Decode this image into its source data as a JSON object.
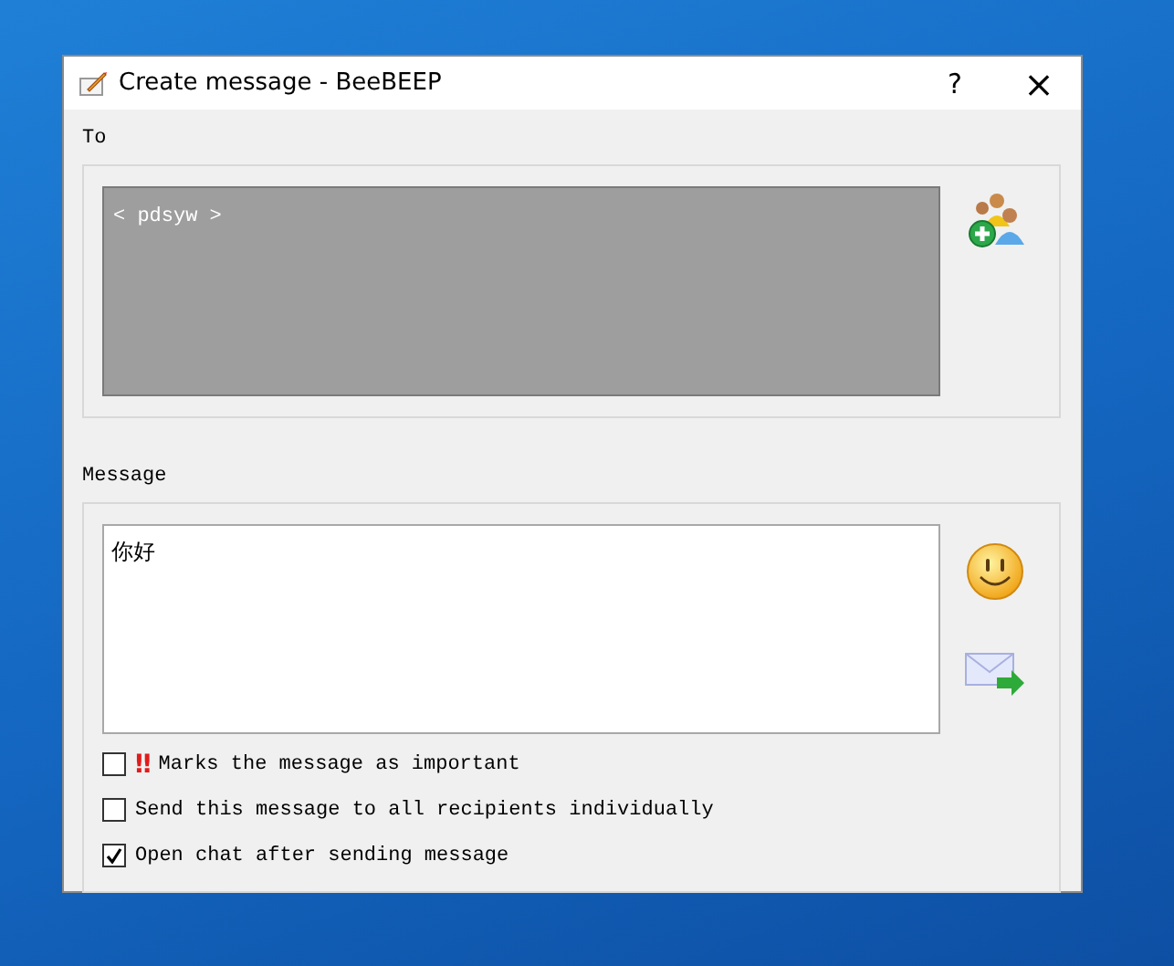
{
  "window": {
    "title": "Create message - BeeBEEP",
    "help": "?",
    "close": "×"
  },
  "to": {
    "label": "To",
    "recipients": "< pdsyw >"
  },
  "message": {
    "label": "Message",
    "value": "你好"
  },
  "options": [
    {
      "label": "Marks the message as important",
      "checked": false,
      "important_mark": "‼"
    },
    {
      "label": "Send this message to all recipients individually",
      "checked": false
    },
    {
      "label": "Open chat after sending message",
      "checked": true
    }
  ]
}
